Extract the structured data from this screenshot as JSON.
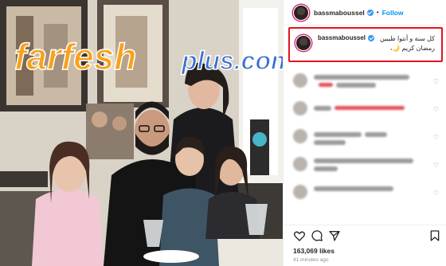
{
  "post": {
    "username": "bassmaboussel",
    "follow_label": "Follow",
    "separator": "•",
    "caption": "كل سنة و أنتوا طيبين رمضان كريم 🌙،",
    "likes": "163,069 likes",
    "time": "41 minutes ago"
  },
  "watermark": {
    "brand_orange": "farfesh",
    "brand_blue": "plus.com"
  },
  "colors": {
    "accent": "#0095f6",
    "highlight": "#e0141e",
    "verified": "#3897f0",
    "watermark_orange": "#f7a21b",
    "watermark_blue": "#3a6fd0"
  },
  "icons": [
    "heart-icon",
    "comment-icon",
    "share-icon",
    "bookmark-icon",
    "verified-icon"
  ]
}
